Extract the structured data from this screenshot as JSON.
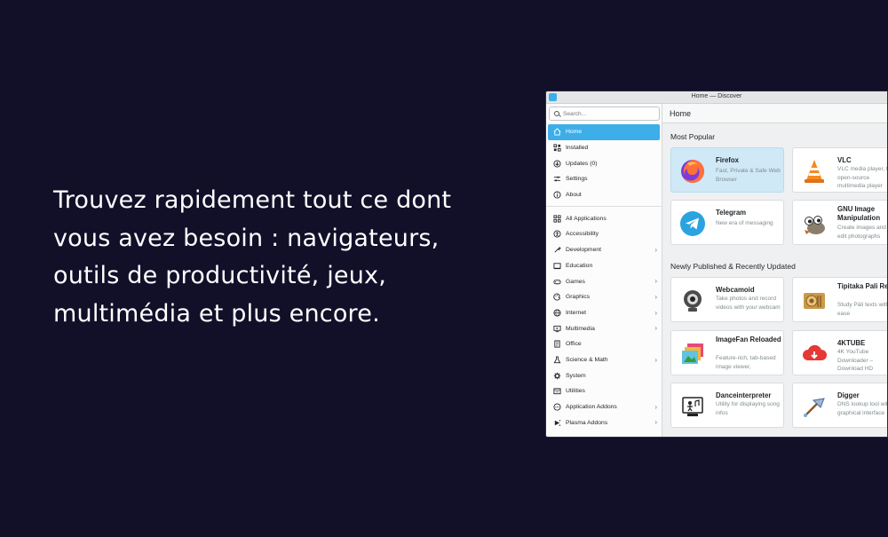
{
  "promo": {
    "line1": "Trouvez rapidement tout ce dont",
    "line2": "vous avez besoin : navigateurs,",
    "line3": "outils de productivité, jeux,",
    "line4": "multimédia et plus encore."
  },
  "window": {
    "title": "Home — Discover"
  },
  "sidebar": {
    "search_placeholder": "Search...",
    "top_items": [
      {
        "label": "Home",
        "icon": "home-icon"
      },
      {
        "label": "Installed",
        "icon": "installed-icon"
      },
      {
        "label": "Updates (0)",
        "icon": "updates-icon"
      },
      {
        "label": "Settings",
        "icon": "settings-icon"
      },
      {
        "label": "About",
        "icon": "about-icon"
      }
    ],
    "categories": [
      {
        "label": "All Applications",
        "icon": "grid-icon"
      },
      {
        "label": "Accessibility",
        "icon": "accessibility-icon"
      },
      {
        "label": "Development",
        "icon": "development-icon"
      },
      {
        "label": "Education",
        "icon": "education-icon"
      },
      {
        "label": "Games",
        "icon": "games-icon"
      },
      {
        "label": "Graphics",
        "icon": "graphics-icon"
      },
      {
        "label": "Internet",
        "icon": "internet-icon"
      },
      {
        "label": "Multimedia",
        "icon": "multimedia-icon"
      },
      {
        "label": "Office",
        "icon": "office-icon"
      },
      {
        "label": "Science & Math",
        "icon": "science-icon"
      },
      {
        "label": "System",
        "icon": "system-icon"
      },
      {
        "label": "Utilities",
        "icon": "utilities-icon"
      },
      {
        "label": "Application Addons",
        "icon": "addons-icon"
      },
      {
        "label": "Plasma Addons",
        "icon": "plasma-addons-icon"
      }
    ]
  },
  "main": {
    "header": "Home",
    "most_popular": "Most Popular",
    "newly_published": "Newly Published & Recently Updated",
    "popular_apps": [
      {
        "name": "Firefox",
        "desc": "Fast, Private & Safe Web Browser",
        "icon": "firefox-icon"
      },
      {
        "name": "VLC",
        "desc": "VLC media player, the open-source multimedia player",
        "icon": "vlc-icon"
      },
      {
        "name": "Telegram",
        "desc": "New era of messaging",
        "icon": "telegram-icon"
      },
      {
        "name": "GNU Image Manipulation",
        "desc": "Create images and edit photographs",
        "icon": "gimp-icon"
      }
    ],
    "new_apps": [
      {
        "name": "Webcamoid",
        "desc": "Take photos and record videos with your webcam",
        "icon": "webcam-icon"
      },
      {
        "name": "Tipitaka Pali Reader",
        "desc": "Study Pāli texts with ease",
        "icon": "tipitaka-icon"
      },
      {
        "name": "ImageFan Reloaded",
        "desc": "Feature-rich, tab-based image viewer,",
        "icon": "imagefan-icon"
      },
      {
        "name": "4KTUBE",
        "desc": "4K YouTube Downloader – Download HD",
        "icon": "4ktube-icon"
      },
      {
        "name": "Danceinterpreter",
        "desc": "Utility for displaying song infos",
        "icon": "danceinterpreter-icon"
      },
      {
        "name": "Digger",
        "desc": "DNS lookup tool with graphical interface",
        "icon": "digger-icon"
      }
    ]
  },
  "colors": {
    "background": "#120f29",
    "accent": "#3daee9",
    "selected_card": "#d0e9f7"
  }
}
